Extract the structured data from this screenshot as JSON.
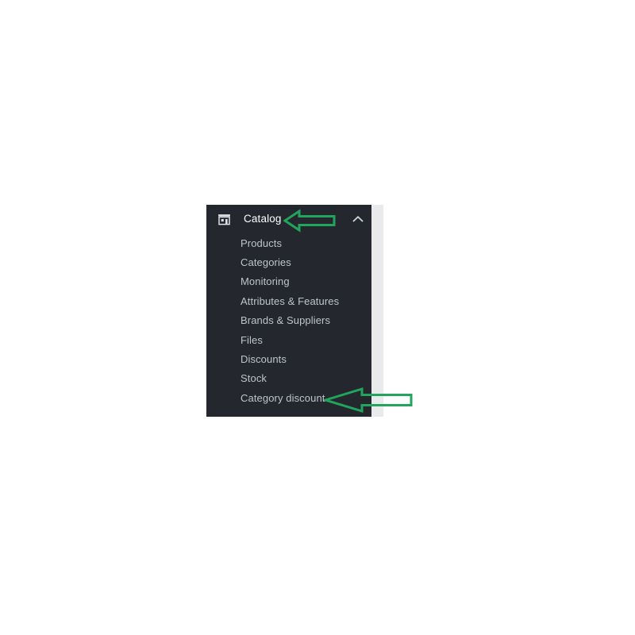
{
  "colors": {
    "panel_background": "#24272d",
    "page_background": "#ffffff",
    "scrollbar_track": "#e8eaec",
    "title_text": "#ffffff",
    "submenu_text": "#bcc5cf",
    "annotation_green": "#22a45d"
  },
  "panel": {
    "header": {
      "icon": "store-icon",
      "title": "Catalog",
      "expand_icon": "chevron-up-icon",
      "expanded": true
    },
    "submenu": [
      {
        "label": "Products"
      },
      {
        "label": "Categories"
      },
      {
        "label": "Monitoring"
      },
      {
        "label": "Attributes & Features"
      },
      {
        "label": "Brands & Suppliers"
      },
      {
        "label": "Files"
      },
      {
        "label": "Discounts"
      },
      {
        "label": "Stock"
      },
      {
        "label": "Category discount"
      }
    ]
  },
  "annotations": [
    {
      "name": "arrow-pointing-to-catalog",
      "direction": "left",
      "target": "Catalog"
    },
    {
      "name": "arrow-pointing-to-category-discount",
      "direction": "left",
      "target": "Category discount"
    }
  ]
}
